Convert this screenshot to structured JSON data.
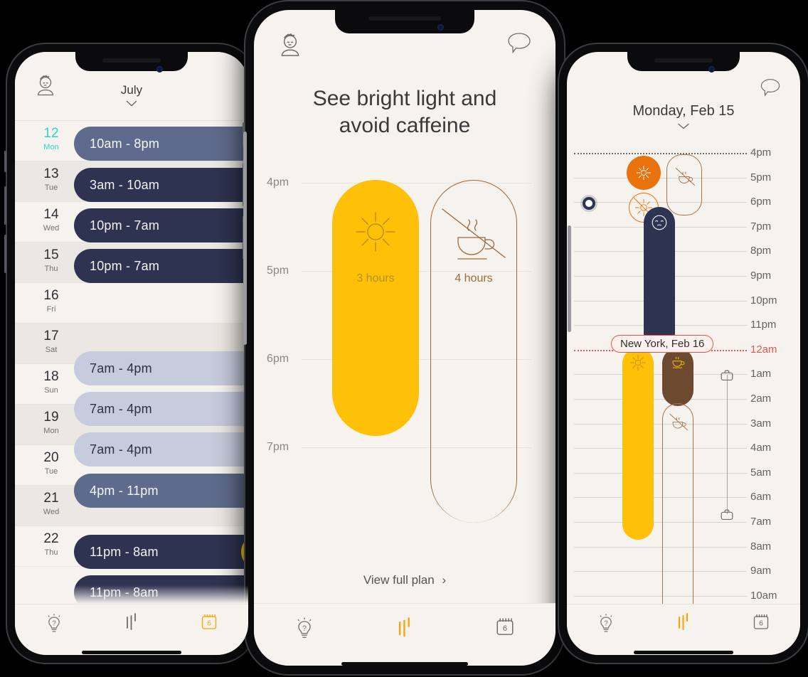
{
  "left_phone": {
    "avatar_icon": "user-avatar-icon",
    "month_label": "July",
    "chevron_icon": "chevron-down-icon",
    "days": [
      {
        "num": "12",
        "dow": "Mon",
        "time": "10am - 8pm",
        "tone": "mid",
        "today": true
      },
      {
        "num": "13",
        "dow": "Tue",
        "time": "3am - 10am",
        "tone": "dark",
        "today": false
      },
      {
        "num": "14",
        "dow": "Wed",
        "time": "10pm - 7am",
        "tone": "dark",
        "today": false
      },
      {
        "num": "15",
        "dow": "Thu",
        "time": "10pm - 7am",
        "tone": "dark",
        "today": false
      },
      {
        "num": "16",
        "dow": "Fri",
        "time": "",
        "tone": "none",
        "today": false
      },
      {
        "num": "17",
        "dow": "Sat",
        "time": "7am - 4pm",
        "tone": "light",
        "today": false
      },
      {
        "num": "18",
        "dow": "Sun",
        "time": "7am - 4pm",
        "tone": "light",
        "today": false
      },
      {
        "num": "19",
        "dow": "Mon",
        "time": "7am - 4pm",
        "tone": "light",
        "today": false
      },
      {
        "num": "20",
        "dow": "Tue",
        "time": "4pm - 11pm",
        "tone": "mid",
        "today": false
      },
      {
        "num": "21",
        "dow": "Wed",
        "time": "11pm - 8am",
        "tone": "dark",
        "today": false
      },
      {
        "num": "22",
        "dow": "Thu",
        "time": "11pm - 8am",
        "tone": "dark",
        "today": false
      }
    ],
    "tabs": [
      {
        "icon": "lightbulb-question-icon",
        "active": false
      },
      {
        "icon": "sleep-waves-icon",
        "active": false
      },
      {
        "icon": "calendar-icon",
        "active": true,
        "day": "6"
      }
    ]
  },
  "center_phone": {
    "avatar_icon": "user-avatar-icon",
    "chat_icon": "speech-bubble-icon",
    "title": "See bright light and avoid caffeine",
    "title_line1": "See bright light and",
    "title_line2": "avoid caffeine",
    "axis_labels": [
      "4pm",
      "5pm",
      "6pm",
      "7pm"
    ],
    "blocks": [
      {
        "name": "bright-light",
        "icon": "sun-icon",
        "duration": "3 hours",
        "start": "4pm",
        "end": "7pm",
        "filled": true,
        "color": "#ffc107"
      },
      {
        "name": "avoid-caffeine",
        "icon": "no-coffee-icon",
        "duration": "4 hours",
        "start": "4pm",
        "end": "8pm",
        "filled": false,
        "color": "#9a6a3a"
      }
    ],
    "link_label": "View full plan",
    "link_chevron": "chevron-right-icon",
    "tabs": [
      {
        "icon": "lightbulb-question-icon",
        "active": false
      },
      {
        "icon": "sleep-waves-icon",
        "active": true
      },
      {
        "icon": "calendar-icon",
        "active": false,
        "day": "6"
      }
    ]
  },
  "right_phone": {
    "chat_icon": "speech-bubble-icon",
    "date_label": "Monday, Feb 15",
    "chevron_icon": "chevron-down-icon",
    "hour_labels": [
      "4pm",
      "5pm",
      "6pm",
      "7pm",
      "8pm",
      "9pm",
      "10pm",
      "11pm",
      "12am",
      "1am",
      "2am",
      "3am",
      "4am",
      "5am",
      "6am",
      "7am",
      "8am",
      "9am",
      "10am"
    ],
    "midnight_label": "12am",
    "city_tag": "New York, Feb 16",
    "now_marker": "current-time-dot",
    "events": [
      {
        "name": "bright-light-evening",
        "icon": "sun-icon",
        "color": "#e8720c",
        "shape": "circle"
      },
      {
        "name": "avoid-light",
        "icon": "no-sun-icon",
        "color": "#e8720c",
        "shape": "circle-outline"
      },
      {
        "name": "avoid-caffeine-pm",
        "icon": "no-coffee-icon",
        "color": "#a5764b",
        "shape": "pill-outline"
      },
      {
        "name": "sleep",
        "icon": "sleeping-face-icon",
        "color": "#2e3351",
        "shape": "pill"
      },
      {
        "name": "bright-light-morning",
        "icon": "sun-icon",
        "color": "#ffc107",
        "shape": "pill"
      },
      {
        "name": "caffeine-ok",
        "icon": "coffee-icon",
        "color": "#6b4a2f",
        "shape": "pill"
      },
      {
        "name": "avoid-caffeine-am",
        "icon": "no-coffee-icon",
        "color": "#a5764b",
        "shape": "pill-outline"
      },
      {
        "name": "work-start",
        "icon": "briefcase-icon",
        "color": "#6e6a65",
        "shape": "marker"
      },
      {
        "name": "work-end",
        "icon": "briefcase-icon",
        "color": "#6e6a65",
        "shape": "marker"
      }
    ],
    "tabs": [
      {
        "icon": "lightbulb-question-icon",
        "active": false
      },
      {
        "icon": "sleep-waves-icon",
        "active": true
      },
      {
        "icon": "calendar-icon",
        "active": false,
        "day": "6"
      }
    ]
  },
  "theme": {
    "bg": "#f6f2ee",
    "bg_alt": "#ebe7e2",
    "navy": "#2e3351",
    "slate": "#5e6b8c",
    "lavender": "#c6cbdd",
    "yellow": "#ffc107",
    "orange": "#e8720c",
    "brown": "#6b4a2f",
    "brown_line": "#a5764b",
    "teal": "#2fd4c8",
    "red": "#ef5350"
  }
}
